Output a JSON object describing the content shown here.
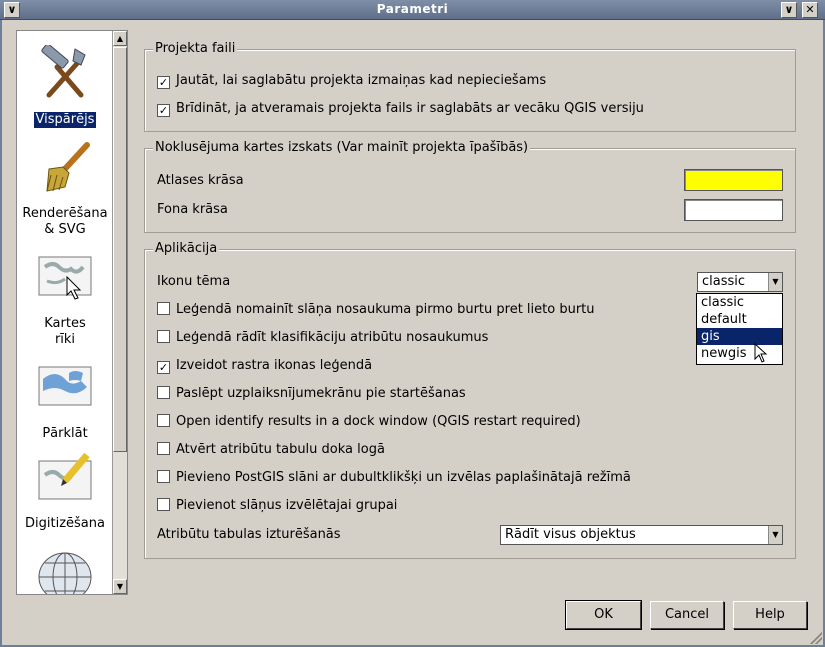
{
  "window": {
    "title": "Parametri",
    "menu_glyph": "∨",
    "minimize_glyph": "∨",
    "close_glyph": "✕"
  },
  "sidebar": {
    "items": [
      {
        "label": "Vispārējs",
        "icon": "tools-icon",
        "selected": true
      },
      {
        "label": "Renderēšana\n& SVG",
        "icon": "brush-icon",
        "selected": false
      },
      {
        "label": "Kartes\nrīki",
        "icon": "map-cursor-icon",
        "selected": false
      },
      {
        "label": "Pārklāt",
        "icon": "map-overlay-icon",
        "selected": false
      },
      {
        "label": "Digitizēšana",
        "icon": "map-pencil-icon",
        "selected": false
      },
      {
        "label": "",
        "icon": "globe-icon",
        "selected": false
      }
    ]
  },
  "project_files": {
    "title": "Projekta faili",
    "options": [
      {
        "label": "Jautāt, lai saglabātu projekta izmaiņas kad nepieciešams",
        "checked": true
      },
      {
        "label": "Brīdināt, ja atveramais projekta fails ir saglabāts ar vecāku QGIS versiju",
        "checked": true
      }
    ]
  },
  "map_defaults": {
    "title": "Noklusējuma kartes izskats (Var mainīt projekta īpašībās)",
    "selection_color_label": "Atlases krāsa",
    "selection_color": "#ffff00",
    "background_color_label": "Fona krāsa",
    "background_color": "#ffffff"
  },
  "application": {
    "title": "Aplikācija",
    "icon_theme_label": "Ikonu tēma",
    "icon_theme_value": "classic",
    "icon_theme_options": [
      "classic",
      "default",
      "gis",
      "newgis"
    ],
    "icon_theme_highlighted": "gis",
    "options": [
      {
        "label": "Leģendā nomainīt slāņa nosaukuma pirmo burtu pret lieto burtu",
        "checked": false
      },
      {
        "label": "Leģendā rādīt klasifikāciju atribūtu nosaukumus",
        "checked": false
      },
      {
        "label": "Izveidot rastra ikonas leģendā",
        "checked": true
      },
      {
        "label": "Paslēpt uzplaiksnījumekrānu pie startēšanas",
        "checked": false
      },
      {
        "label": "Open identify results in a dock window (QGIS restart required)",
        "checked": false
      },
      {
        "label": "Atvērt atribūtu tabulu doka logā",
        "checked": false
      },
      {
        "label": "Pievieno PostGIS slāni ar dubultklikšķi un izvēlas paplašinātajā režīmā",
        "checked": false
      },
      {
        "label": "Pievienot slāņus izvēlētajai grupai",
        "checked": false
      }
    ],
    "attr_table_label": "Atribūtu tabulas izturēšanās",
    "attr_table_value": "Rādīt visus objektus"
  },
  "buttons": {
    "ok": "OK",
    "cancel": "Cancel",
    "help": "Help"
  },
  "colors": {
    "accent": "#0a246a",
    "window_bg": "#d4d0c8",
    "title_bar": "#6f7f99"
  }
}
